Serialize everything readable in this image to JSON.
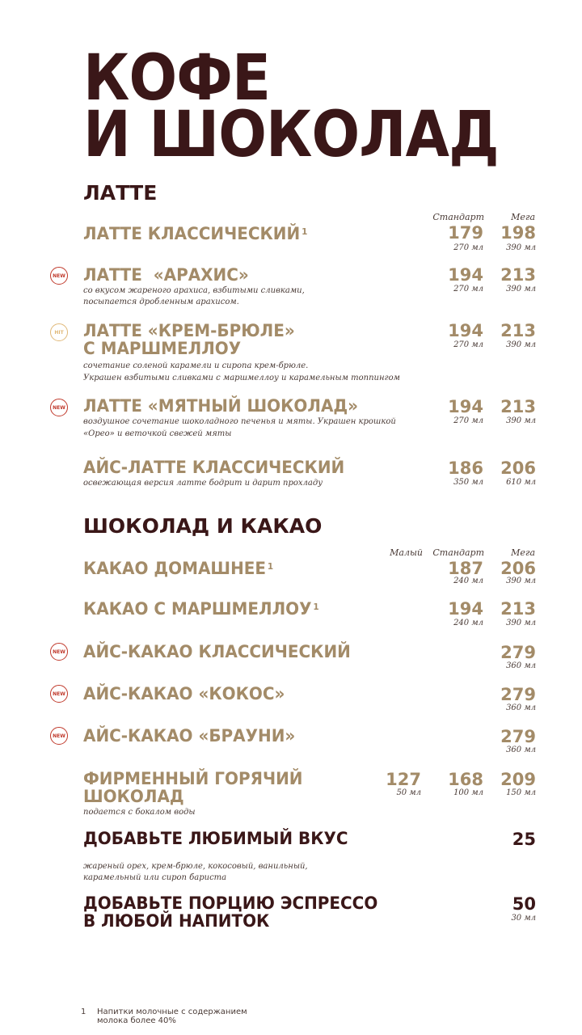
{
  "title": {
    "line1": "КОФЕ",
    "line2": "И ШОКОЛАД"
  },
  "latte": {
    "heading": "ЛАТТЕ",
    "col_standard": "Стандарт",
    "col_mega": "Мега",
    "items": [
      {
        "name": "ЛАТТЕ КЛАССИЧЕСКИЙ",
        "sup": "1",
        "desc1": "",
        "desc2": "",
        "price_standard": "179",
        "vol_standard": "270 мл",
        "price_mega": "198",
        "vol_mega": "390 мл"
      },
      {
        "badge": "NEW",
        "name": "ЛАТТЕ  «АРАХИС»",
        "desc1": "со вкусом жареного арахиса, взбитыми сливками,",
        "desc2": "посыпается дробленным арахисом.",
        "price_standard": "194",
        "vol_standard": "270 мл",
        "price_mega": "213",
        "vol_mega": "390 мл"
      },
      {
        "badge": "HIT",
        "name1": "ЛАТТЕ «КРЕМ-БРЮЛЕ»",
        "name2": "С МАРШМЕЛЛОУ",
        "desc1": "сочетание соленой карамели и сиропа крем-брюле.",
        "desc2": "Украшен взбитыми сливками с маршмеллоу и карамельным топпингом",
        "price_standard": "194",
        "vol_standard": "270 мл",
        "price_mega": "213",
        "vol_mega": "390 мл"
      },
      {
        "badge": "NEW",
        "name": "ЛАТТЕ «МЯТНЫЙ ШОКОЛАД»",
        "desc1": "воздушное сочетание шоколадного печенья и мяты. Украшен крошкой",
        "desc2": "«Орео» и веточкой свежей мяты",
        "price_standard": "194",
        "vol_standard": "270 мл",
        "price_mega": "213",
        "vol_mega": "390 мл"
      },
      {
        "name": "АЙС-ЛАТТЕ КЛАССИЧЕСКИЙ",
        "desc1": "освежающая версия латте бодрит и дарит прохладу",
        "price_standard": "186",
        "vol_standard": "350 мл",
        "price_mega": "206",
        "vol_mega": "610 мл"
      }
    ]
  },
  "choco": {
    "heading": "ШОКОЛАД И КАКАО",
    "col_small": "Малый",
    "col_standard": "Стандарт",
    "col_mega": "Мега",
    "items": [
      {
        "name": "КАКАО ДОМАШНЕЕ",
        "sup": "1",
        "price_standard": "187",
        "vol_standard": "240 мл",
        "price_mega": "206",
        "vol_mega": "390 мл"
      },
      {
        "name": "КАКАО С МАРШМЕЛЛОУ",
        "sup": "1",
        "price_standard": "194",
        "vol_standard": "240 мл",
        "price_mega": "213",
        "vol_mega": "390 мл"
      },
      {
        "badge": "NEW",
        "name": "АЙС-КАКАО КЛАССИЧЕСКИЙ",
        "price_mega": "279",
        "vol_mega": "360 мл"
      },
      {
        "badge": "NEW",
        "name": "АЙС-КАКАО «КОКОС»",
        "price_mega": "279",
        "vol_mega": "360 мл"
      },
      {
        "badge": "NEW",
        "name": "АЙС-КАКАО «БРАУНИ»",
        "price_mega": "279",
        "vol_mega": "360 мл"
      },
      {
        "name1": "ФИРМЕННЫЙ ГОРЯЧИЙ",
        "name2": "ШОКОЛАД",
        "desc1": "подается с бокалом воды",
        "price_small": "127",
        "vol_small": "50 мл",
        "price_standard": "168",
        "vol_standard": "100 мл",
        "price_mega": "209",
        "vol_mega": "150 мл"
      }
    ]
  },
  "extras": {
    "flavor": {
      "name": "ДОБАВЬТЕ ЛЮБИМЫЙ ВКУС",
      "desc1": "жареный орех, крем-брюле, кокосовый, ванильный,",
      "desc2": "карамельный или сироп бариста",
      "price": "25"
    },
    "espresso": {
      "name1": "ДОБАВЬТЕ ПОРЦИЮ ЭСПРЕССО",
      "name2": "В ЛЮБОЙ НАПИТОК",
      "price": "50",
      "vol": "30 мл"
    }
  },
  "footnote": {
    "num": "1",
    "line1": "Напитки молочные с содержанием",
    "line2": "молока более 40%"
  },
  "colors": {
    "title": "#3a1718",
    "gold": "#a38b68",
    "new_badge": "#c0392b",
    "hit_badge": "#e0b878"
  }
}
